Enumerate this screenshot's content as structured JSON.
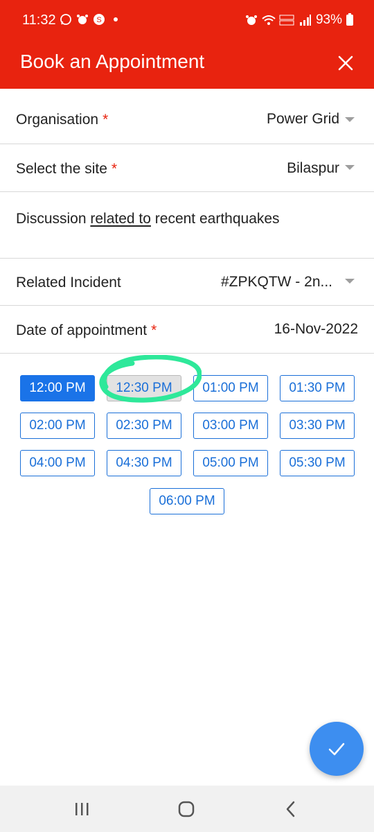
{
  "status_bar": {
    "time": "11:32",
    "battery": "93%",
    "left_icons": [
      "whatsapp-icon",
      "alarm-icon",
      "s-app-icon"
    ],
    "right_icons": [
      "alarm-icon",
      "wifi-icon",
      "volte-lte-icon",
      "signal-icon",
      "battery-icon"
    ]
  },
  "appbar": {
    "title": "Book an Appointment",
    "color": "#e8230f"
  },
  "form": {
    "organisation": {
      "label": "Organisation",
      "required": "*",
      "value": "Power Grid"
    },
    "site": {
      "label": "Select the site",
      "required": "*",
      "value": "Bilaspur"
    },
    "description": {
      "before": "Discussion ",
      "underlined": "related to",
      "after": " recent earthquakes"
    },
    "incident": {
      "label": "Related Incident",
      "value": "#ZPKQTW - 2n..."
    },
    "date": {
      "label": "Date of appointment",
      "required": "*",
      "value": "16-Nov-2022"
    }
  },
  "time_slots": [
    {
      "label": "12:00 PM",
      "state": "selected"
    },
    {
      "label": "12:30 PM",
      "state": "disabled"
    },
    {
      "label": "01:00 PM",
      "state": "available"
    },
    {
      "label": "01:30 PM",
      "state": "available"
    },
    {
      "label": "02:00 PM",
      "state": "available"
    },
    {
      "label": "02:30 PM",
      "state": "available"
    },
    {
      "label": "03:00 PM",
      "state": "available"
    },
    {
      "label": "03:30 PM",
      "state": "available"
    },
    {
      "label": "04:00 PM",
      "state": "available"
    },
    {
      "label": "04:30 PM",
      "state": "available"
    },
    {
      "label": "05:00 PM",
      "state": "available"
    },
    {
      "label": "05:30 PM",
      "state": "available"
    },
    {
      "label": "06:00 PM",
      "state": "available"
    }
  ],
  "colors": {
    "accent_blue": "#1a73e8",
    "fab": "#3d8ef0",
    "annotation_green": "#2ee89a"
  },
  "fab": {
    "icon": "checkmark-icon"
  },
  "navbar": {
    "icons": [
      "recent-apps-icon",
      "home-icon",
      "back-icon"
    ]
  }
}
